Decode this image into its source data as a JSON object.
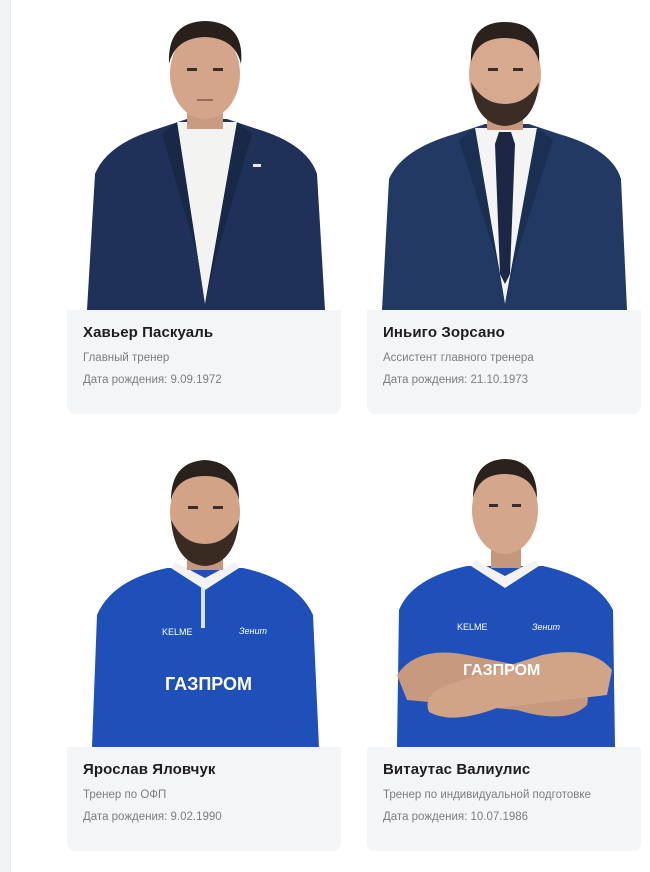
{
  "staff": [
    {
      "name": "Хавьер Паскуаль",
      "role": "Главный тренер",
      "dob": "Дата рождения: 9.09.1972"
    },
    {
      "name": "Иньиго Зорсано",
      "role": "Ассистент главного тренера",
      "dob": "Дата рождения: 21.10.1973"
    },
    {
      "name": "Ярослав Яловчук",
      "role": "Тренер по ОФП",
      "dob": "Дата рождения: 9.02.1990"
    },
    {
      "name": "Витаутас Валиулис",
      "role": "Тренер по индивидуальной подготовке",
      "dob": "Дата рождения: 10.07.1986"
    }
  ],
  "shirt": {
    "sponsor": "ГАЗПРОМ",
    "brand": "KELME"
  },
  "colors": {
    "card_bg": "#f4f5f7",
    "suit": "#1f3158",
    "jersey": "#1f4fb8",
    "accent_text": "#7b7d83"
  }
}
